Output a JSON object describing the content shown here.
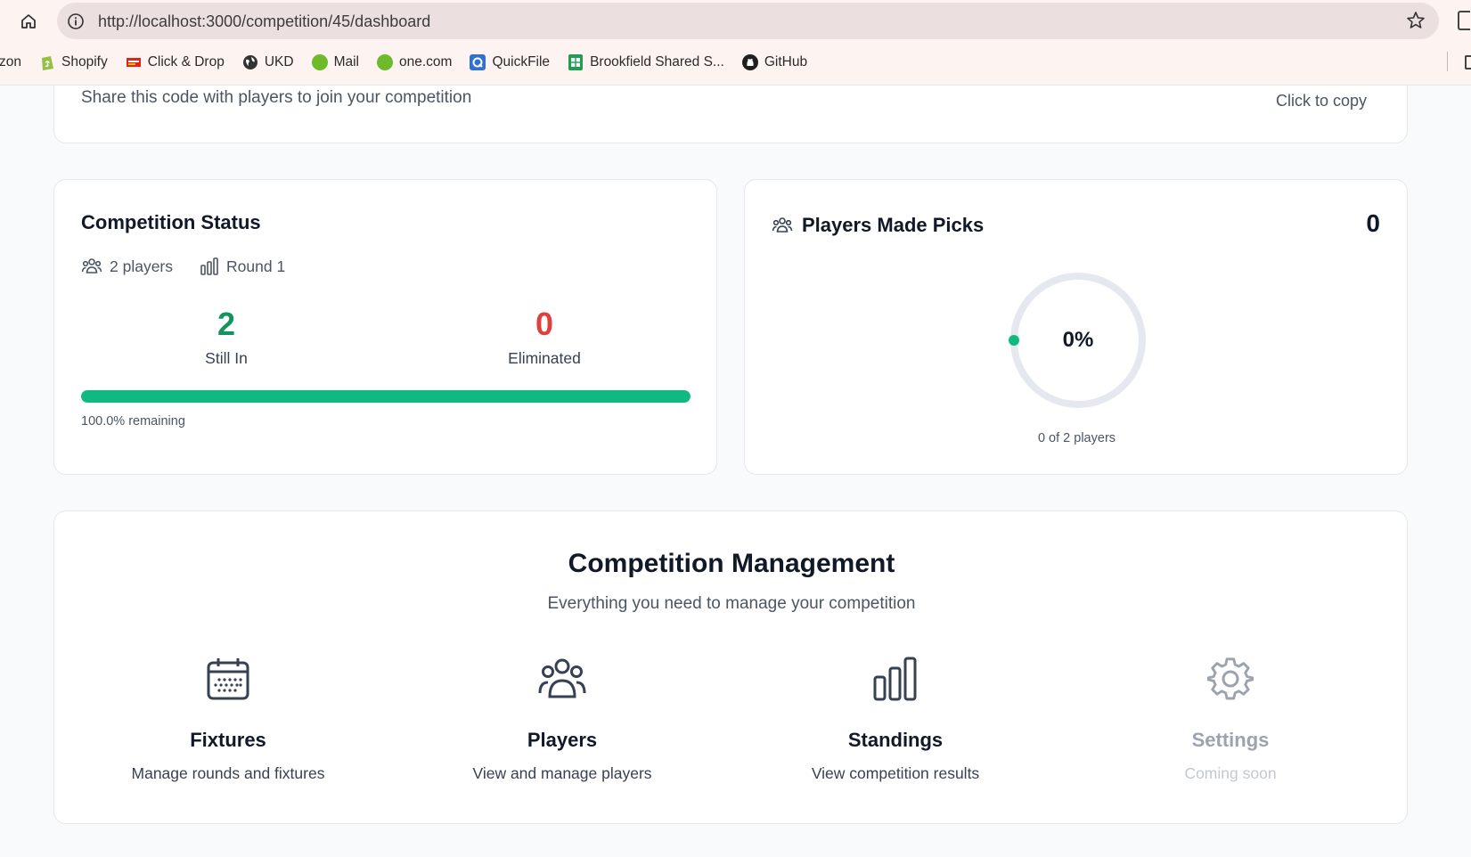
{
  "browser": {
    "url": "http://localhost:3000/competition/45/dashboard",
    "bookmarks": [
      {
        "label": "zon",
        "icon": "truncated"
      },
      {
        "label": "Shopify",
        "icon": "shopify-icon"
      },
      {
        "label": "Click & Drop",
        "icon": "royal-mail-icon"
      },
      {
        "label": "UKD",
        "icon": "globe-icon"
      },
      {
        "label": "Mail",
        "icon": "green-dot-icon"
      },
      {
        "label": "one.com",
        "icon": "green-dot-icon"
      },
      {
        "label": "QuickFile",
        "icon": "quickfile-icon"
      },
      {
        "label": "Brookfield Shared S...",
        "icon": "sheets-icon"
      },
      {
        "label": "GitHub",
        "icon": "github-icon"
      }
    ]
  },
  "invite": {
    "subtitle": "Share this code with players to join your competition",
    "copy_hint": "Click to copy"
  },
  "status": {
    "title": "Competition Status",
    "players": "2 players",
    "round": "Round 1",
    "still_in": "2",
    "still_in_label": "Still In",
    "eliminated": "0",
    "eliminated_label": "Eliminated",
    "remaining_fraction": 1.0,
    "remaining_text": "100.0% remaining"
  },
  "picks": {
    "title": "Players Made Picks",
    "count": "0",
    "percent_label": "0%",
    "fraction": 0,
    "caption": "0 of 2 players"
  },
  "management": {
    "title": "Competition Management",
    "subtitle": "Everything you need to manage your competition",
    "tiles": [
      {
        "name": "Fixtures",
        "desc": "Manage rounds and fixtures",
        "icon": "calendar-icon"
      },
      {
        "name": "Players",
        "desc": "View and manage players",
        "icon": "users-icon"
      },
      {
        "name": "Standings",
        "desc": "View competition results",
        "icon": "bar-chart-icon"
      },
      {
        "name": "Settings",
        "desc": "Coming soon",
        "icon": "gear-icon"
      }
    ]
  },
  "colors": {
    "accent_green": "#10b981",
    "still_in_green": "#15935f",
    "eliminated_red": "#e0403a"
  }
}
